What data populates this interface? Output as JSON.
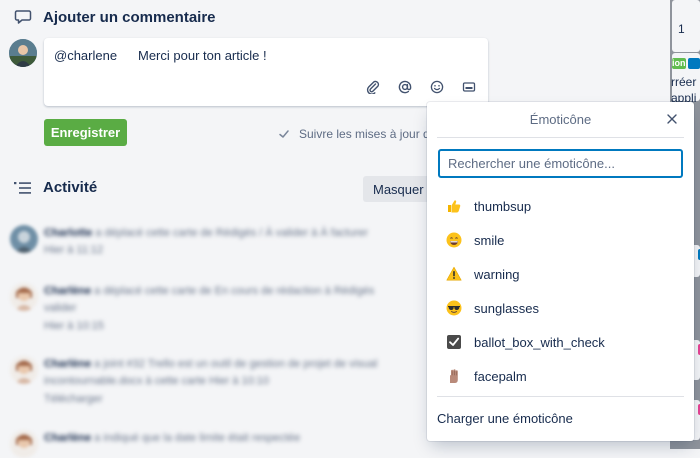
{
  "comment_section": {
    "title": "Ajouter un commentaire",
    "mention": "@charlene",
    "text": "Merci pour ton article !",
    "save_label": "Enregistrer",
    "follow_label": "Suivre les mises à jour de"
  },
  "activity": {
    "title": "Activité",
    "hide_label": "Masquer l",
    "items": [
      {
        "author": "Charlotte",
        "text": "a déplacé cette carte de Rédigés / À valider à À facturer",
        "meta": "Hier à 11:12"
      },
      {
        "author": "Charlène",
        "text": "a déplacé cette carte de En cours de rédaction à Rédigés",
        "line2": "valider",
        "meta": "Hier à 10:15"
      },
      {
        "author": "Charlène",
        "text": "a joint #32 Trello est un outil de gestion de projet de visual",
        "line2": "incontournable.docx à cette carte   Hier à 10:10",
        "meta": "Télécharger"
      },
      {
        "author": "Charlène",
        "text": "a indiqué que la date limite était respectée",
        "meta": ""
      }
    ]
  },
  "emoji_popover": {
    "title": "Émoticône",
    "search_placeholder": "Rechercher une émoticône...",
    "items": [
      {
        "name": "thumbsup",
        "glyph": "👍"
      },
      {
        "name": "smile",
        "glyph": "😄"
      },
      {
        "name": "warning",
        "glyph": "⚠"
      },
      {
        "name": "sunglasses",
        "glyph": "😎"
      },
      {
        "name": "ballot_box_with_check",
        "glyph": "☑"
      },
      {
        "name": "facepalm",
        "glyph": "🤦"
      }
    ],
    "footer_label": "Charger une émoticône"
  },
  "right_strip": {
    "top_text": "1",
    "tag_label": "ion",
    "text1": "rréer",
    "text2": "appli"
  },
  "colors": {
    "accent_blue": "#0079bf",
    "save_green": "#5aac44"
  }
}
